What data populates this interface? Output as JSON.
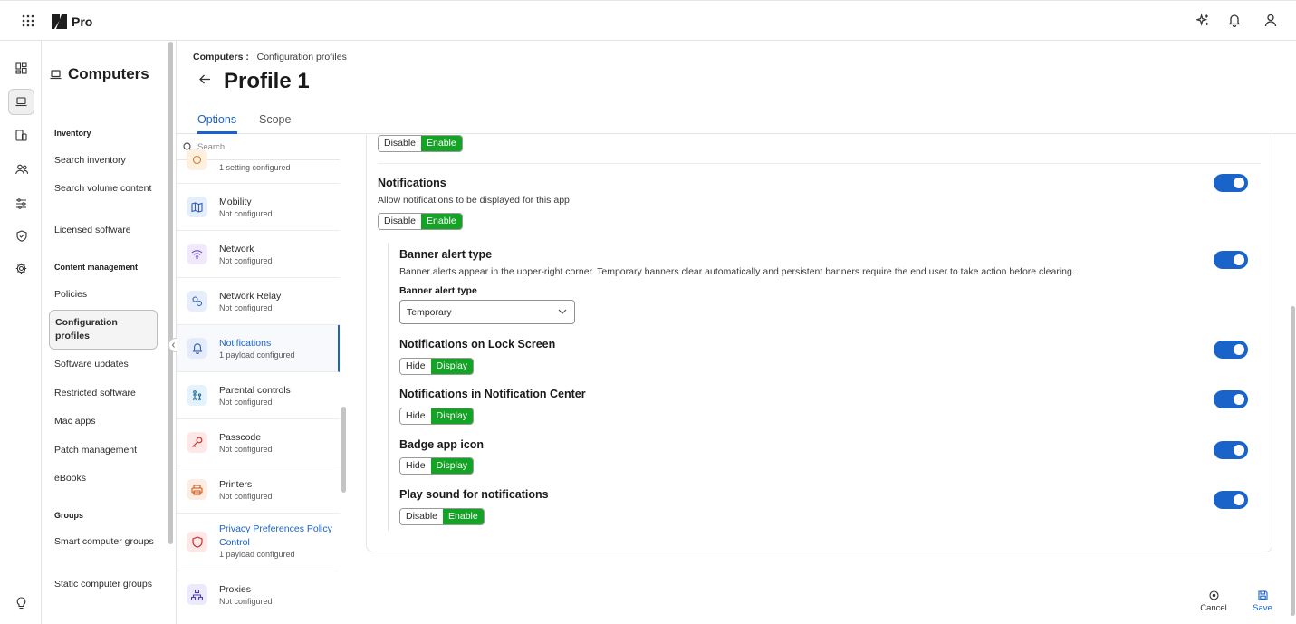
{
  "app": {
    "brand": "Pro"
  },
  "nav": {
    "title": "Computers",
    "sections": [
      {
        "label": "Inventory",
        "items": [
          "Search inventory",
          "Search volume content",
          "Licensed software"
        ]
      },
      {
        "label": "Content management",
        "items": [
          "Policies",
          "Configuration profiles",
          "Software updates",
          "Restricted software",
          "Mac apps",
          "Patch management",
          "eBooks"
        ]
      },
      {
        "label": "Groups",
        "items": [
          "Smart computer groups",
          "Static computer groups"
        ]
      }
    ]
  },
  "breadcrumb": {
    "root": "Computers :",
    "current": "Configuration profiles"
  },
  "page": {
    "title": "Profile 1"
  },
  "tabs": [
    "Options",
    "Scope"
  ],
  "payloads": {
    "search_placeholder": "Search...",
    "items": [
      {
        "name": "",
        "status": "1 setting configured"
      },
      {
        "name": "Mobility",
        "status": "Not configured"
      },
      {
        "name": "Network",
        "status": "Not configured"
      },
      {
        "name": "Network Relay",
        "status": "Not configured"
      },
      {
        "name": "Notifications",
        "status": "1 payload configured"
      },
      {
        "name": "Parental controls",
        "status": "Not configured"
      },
      {
        "name": "Passcode",
        "status": "Not configured"
      },
      {
        "name": "Printers",
        "status": "Not configured"
      },
      {
        "name": "Privacy Preferences Policy Control",
        "status": "1 payload configured"
      },
      {
        "name": "Proxies",
        "status": "Not configured"
      }
    ]
  },
  "settings": {
    "top_seg": [
      "Disable",
      "Enable"
    ],
    "notifications": {
      "title": "Notifications",
      "desc": "Allow notifications to be displayed for this app",
      "seg": [
        "Disable",
        "Enable"
      ]
    },
    "banner": {
      "title": "Banner alert type",
      "desc": "Banner alerts appear in the upper-right corner. Temporary banners clear automatically and persistent banners require the end user to take action before clearing.",
      "field_label": "Banner alert type",
      "selected": "Temporary"
    },
    "lock_screen": {
      "title": "Notifications on Lock Screen",
      "seg": [
        "Hide",
        "Display"
      ]
    },
    "notification_center": {
      "title": "Notifications in Notification Center",
      "seg": [
        "Hide",
        "Display"
      ]
    },
    "badge": {
      "title": "Badge app icon",
      "seg": [
        "Hide",
        "Display"
      ]
    },
    "sound": {
      "title": "Play sound for notifications",
      "seg": [
        "Disable",
        "Enable"
      ]
    }
  },
  "footer": {
    "cancel": "Cancel",
    "save": "Save"
  },
  "colors": {
    "accent": "#1a63c9",
    "enabled": "#13a325"
  }
}
